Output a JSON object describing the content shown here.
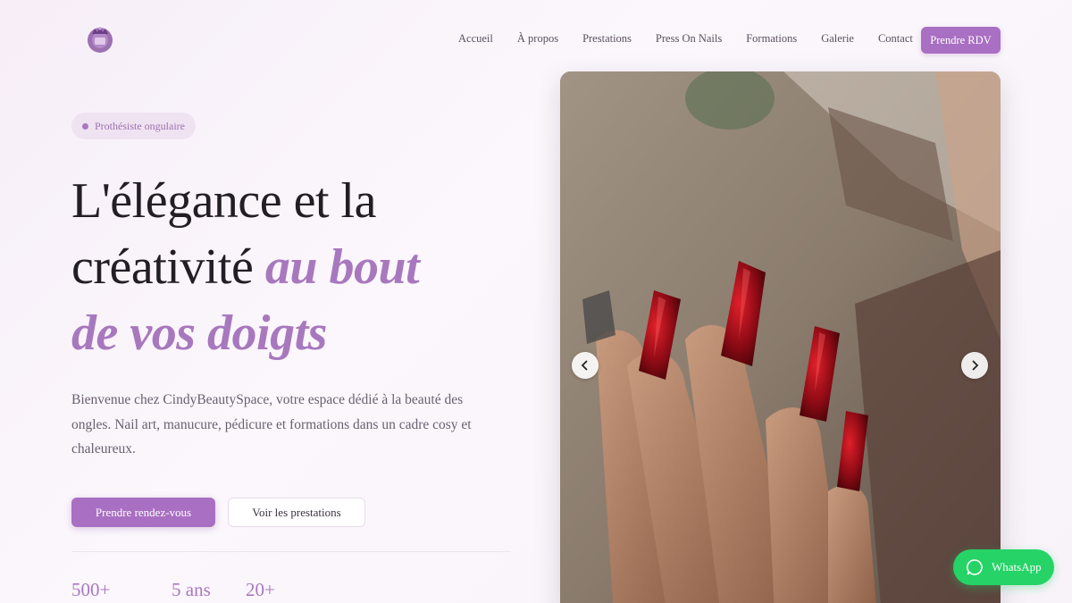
{
  "header": {
    "logo_icon": "crown-nail-logo-icon",
    "nav": [
      "Accueil",
      "À propos",
      "Prestations",
      "Press On Nails",
      "Formations",
      "Galerie",
      "Contact"
    ],
    "cta": "Prendre RDV"
  },
  "hero": {
    "badge": "Prothésiste ongulaire",
    "headline_line1": "L'élégance et la",
    "headline_line2_plain": "créativité ",
    "headline_line2_accent": "au bout",
    "headline_line3_accent": "de vos doigts",
    "intro": "Bienvenue chez CindyBeautySpace, votre espace dédié à la beauté des ongles. Nail art, manucure, pédicure et formations dans un cadre cosy et chaleureux.",
    "primary_button": "Prendre rendez-vous",
    "secondary_button": "Voir les prestations",
    "stats": [
      "500+",
      "5 ans",
      "20+"
    ],
    "image_description": "hand-with-red-nails-photo",
    "prev_icon": "chevron-left-icon",
    "next_icon": "chevron-right-icon"
  },
  "whatsapp": {
    "label": "WhatsApp",
    "icon": "whatsapp-icon"
  },
  "colors": {
    "accent": "#a96fc2",
    "accent_text": "#a878be",
    "whatsapp": "#25d366",
    "heading": "#231d26"
  }
}
